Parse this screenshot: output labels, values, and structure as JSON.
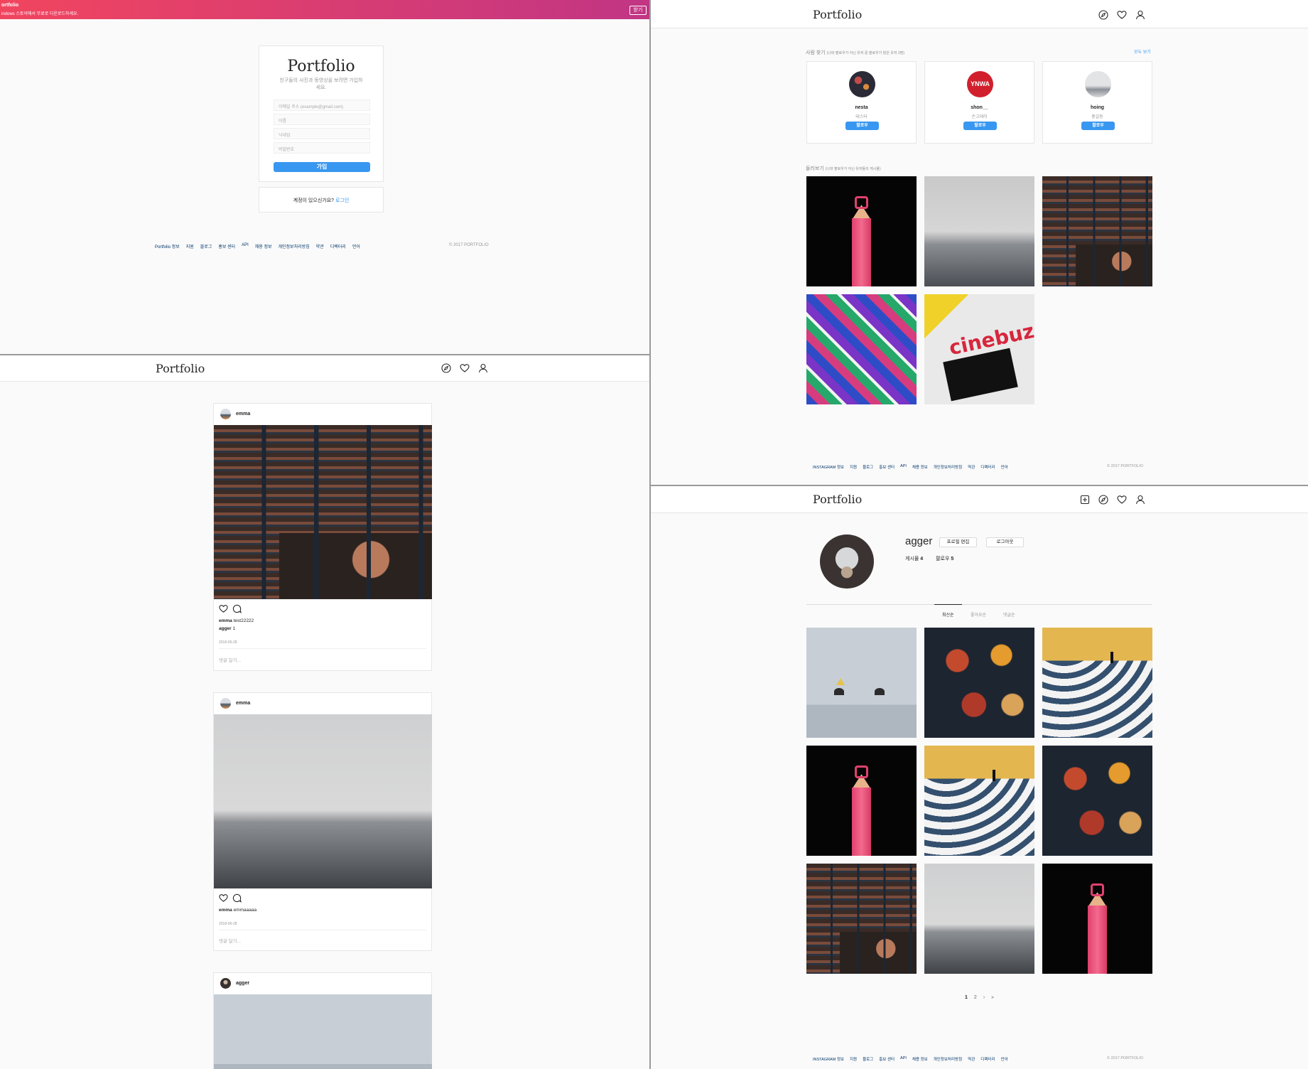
{
  "banner": {
    "title": "ortfolio",
    "subtitle": "indows 스토어에서 무료로 다운로드하세요.",
    "button": "받기"
  },
  "signup": {
    "logo": "Portfolio",
    "tagline": "친구들의 사진과 동영상을 보려면 가입하세요.",
    "email_placeholder": "이메일 주소 (example@gmail.com)",
    "name_placeholder": "이름",
    "nickname_placeholder": "닉네임",
    "password_placeholder": "비밀번호",
    "submit": "가입",
    "have_account": "계정이 있으신가요?",
    "login_link": "로그인"
  },
  "footer_a": {
    "links": [
      "Portfolio 정보",
      "지원",
      "블로그",
      "홍보 센터",
      "API",
      "채용 정보",
      "개인정보처리방침",
      "약관",
      "디렉터리",
      "언어"
    ],
    "copyright": "© 2017 PORTFOLIO"
  },
  "footer_b": {
    "links": [
      "INSTAGRAM 정보",
      "지원",
      "블로그",
      "홍보 센터",
      "API",
      "채용 정보",
      "개인정보처리방침",
      "약관",
      "디렉터리",
      "언어"
    ],
    "copyright": "© 2017 PORTFOLIO"
  },
  "nav": {
    "logo": "Portfolio"
  },
  "explore": {
    "people_heading": "사람 찾기",
    "people_note": "(나와 팔로우가 아닌 유저 중 팔로우가 많은 유저 3명)",
    "see_all": "모두 보기",
    "people": [
      {
        "username": "nesta",
        "name": "테스터",
        "follow": "팔로우"
      },
      {
        "username": "shon__",
        "name": "손고테러",
        "follow": "팔로우",
        "avatar_text": "YNWA"
      },
      {
        "username": "hoing",
        "name": "홍길동",
        "follow": "팔로우"
      }
    ],
    "browse_heading": "둘러보기",
    "browse_note": "(나와 팔로우가 아닌 유저들의 게시물)"
  },
  "feed": {
    "posts": [
      {
        "author": "emma",
        "caption_user": "emma",
        "caption": "test22222",
        "comment_user": "agger",
        "comment": "1",
        "date": "2018-06-28",
        "comment_placeholder": "댓글 달기..."
      },
      {
        "author": "emma",
        "caption_user": "emma",
        "caption": "emmaaaaa",
        "date": "2018-06-28",
        "comment_placeholder": "댓글 달기..."
      },
      {
        "author": "agger"
      }
    ]
  },
  "profile": {
    "username": "agger",
    "edit_button": "프로필 편집",
    "logout_button": "로그아웃",
    "posts_label": "게시물",
    "posts_count": "4",
    "following_label": "팔로우",
    "following_count": "5",
    "tabs": [
      "최신순",
      "좋아요순",
      "댓글순"
    ],
    "pagination": [
      "1",
      "2",
      "›",
      "»"
    ]
  },
  "colors": {
    "accent": "#3897f0",
    "banner_start": "#f1455f",
    "banner_end": "#c13584"
  }
}
